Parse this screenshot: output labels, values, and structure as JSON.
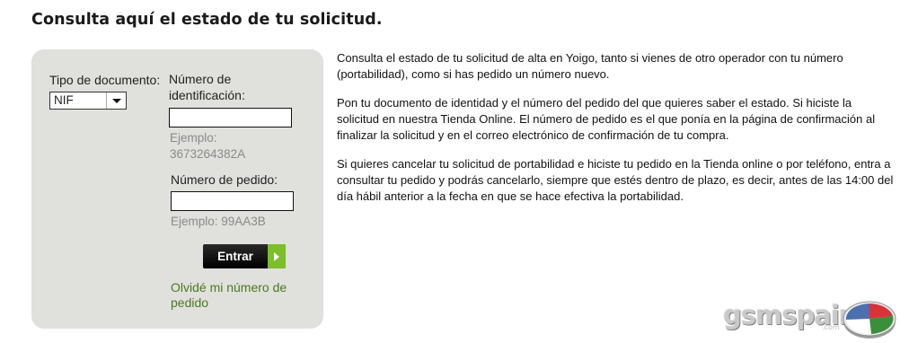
{
  "page": {
    "title": "Consulta aquí el estado de tu solicitud."
  },
  "form": {
    "doc_type_label": "Tipo de documento:",
    "doc_type_value": "NIF",
    "id_label": "Número de identificación:",
    "id_value": "",
    "id_hint_prefix": "Ejemplo:",
    "id_hint_value": "3673264382A",
    "order_label": "Número de pedido:",
    "order_value": "",
    "order_hint": "Ejemplo: 99AA3B",
    "submit_label": "Entrar",
    "forgot_link": "Olvidé mi número de pedido"
  },
  "info": {
    "paragraphs": [
      "Consulta el estado de tu solicitud de alta en Yoigo, tanto si vienes de otro operador con tu número (portabilidad), como si has pedido un número nuevo.",
      "Pon tu documento de identidad y el número del pedido del que quieres saber el estado. Si hiciste la solicitud en nuestra Tienda Online. El número de pedido es el que ponía en la página de confirmación al finalizar la solicitud y en el correo electrónico de confirmación de tu compra.",
      "Si quieres cancelar tu solicitud de portabilidad e hiciste tu pedido en la Tienda online o por teléfono, entra a consultar tu pedido y podrás cancelarlo, siempre que estés dentro de plazo, es decir, antes de las 14:00 del día hábil anterior a la fecha en que se hace efectiva la portabilidad."
    ]
  },
  "watermark": {
    "brand": "gsmspain",
    "suffix": ".com",
    "icon": "pie-chart-logo-icon"
  },
  "colors": {
    "panel_bg": "#e0e0dd",
    "link": "#4a7a1e",
    "button_accent": "#7bbf2a",
    "hint_text": "#8a8a8a"
  }
}
